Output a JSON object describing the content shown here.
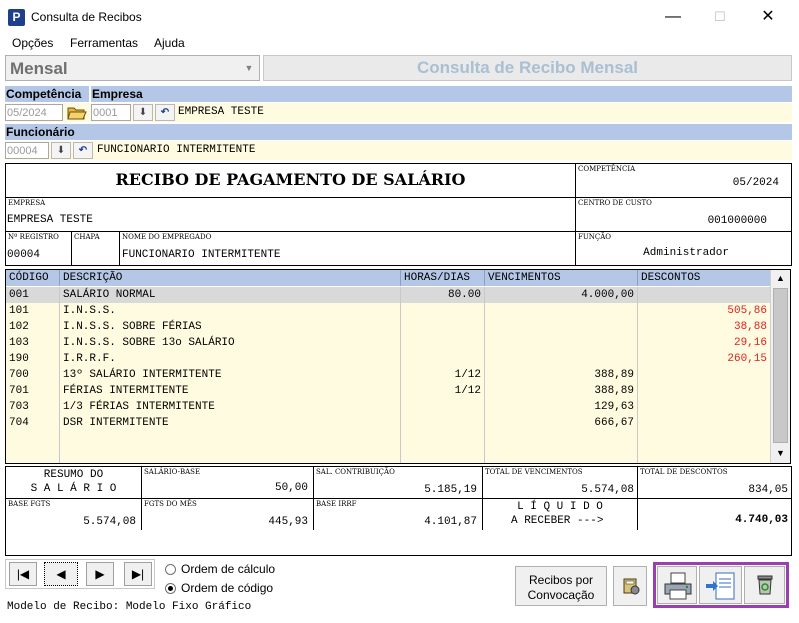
{
  "window": {
    "title": "Consulta de Recibos",
    "icon_letter": "P",
    "minimize": "—",
    "maximize": "☐",
    "close": "✕"
  },
  "menu": [
    "Opções",
    "Ferramentas",
    "Ajuda"
  ],
  "header": {
    "mode_selected": "Mensal",
    "screen_title": "Consulta de Recibo Mensal"
  },
  "filters": {
    "competencia_label": "Competência",
    "competencia_value": "05/2024",
    "empresa_label": "Empresa",
    "empresa_code": "0001",
    "empresa_name": "EMPRESA TESTE",
    "funcionario_label": "Funcionário",
    "funcionario_code": "00004",
    "funcionario_name": "FUNCIONARIO INTERMITENTE"
  },
  "receipt": {
    "title": "RECIBO DE PAGAMENTO DE SALÁRIO",
    "competencia_label": "COMPETÊNCIA",
    "competencia": "05/2024",
    "empresa_label": "EMPRESA",
    "empresa": "EMPRESA TESTE",
    "centro_custo_label": "CENTRO DE CUSTO",
    "centro_custo": "001000000",
    "registro_label": "Nº REGISTRO",
    "registro": "00004",
    "chapa_label": "CHAPA",
    "chapa": "",
    "nome_label": "NOME DO EMPREGADO",
    "nome": "FUNCIONARIO INTERMITENTE",
    "funcao_label": "FUNÇÃO",
    "funcao": "Administrador"
  },
  "grid": {
    "columns": [
      "CÓDIGO",
      "DESCRIÇÃO",
      "HORAS/DIAS",
      "VENCIMENTOS",
      "DESCONTOS"
    ],
    "rows": [
      {
        "code": "001",
        "desc": "SALÁRIO NORMAL",
        "hours": "80.00",
        "venc": "4.000,00",
        "desc_val": "",
        "highlight": true
      },
      {
        "code": "101",
        "desc": "I.N.S.S.",
        "hours": "",
        "venc": "",
        "desc_val": "505,86"
      },
      {
        "code": "102",
        "desc": "I.N.S.S. SOBRE FÉRIAS",
        "hours": "",
        "venc": "",
        "desc_val": "38,88"
      },
      {
        "code": "103",
        "desc": "I.N.S.S. SOBRE 13o SALÁRIO",
        "hours": "",
        "venc": "",
        "desc_val": "29,16"
      },
      {
        "code": "190",
        "desc": "I.R.R.F.",
        "hours": "",
        "venc": "",
        "desc_val": "260,15"
      },
      {
        "code": "700",
        "desc": "13º SALÁRIO INTERMITENTE",
        "hours": "1/12",
        "venc": "388,89",
        "desc_val": ""
      },
      {
        "code": "701",
        "desc": "FÉRIAS INTERMITENTE",
        "hours": "1/12",
        "venc": "388,89",
        "desc_val": ""
      },
      {
        "code": "703",
        "desc": "1/3 FÉRIAS INTERMITENTE",
        "hours": "",
        "venc": "129,63",
        "desc_val": ""
      },
      {
        "code": "704",
        "desc": "DSR INTERMITENTE",
        "hours": "",
        "venc": "666,67",
        "desc_val": ""
      }
    ]
  },
  "summary": {
    "resumo_line1": "RESUMO DO",
    "resumo_line2": "S A L Á R I O",
    "salario_base_label": "SALÁRIO-BASE",
    "salario_base": "50,00",
    "sal_contrib_label": "SAL. CONTRIBUIÇÃO",
    "sal_contrib": "5.185,19",
    "total_venc_label": "TOTAL DE VENCIMENTOS",
    "total_venc": "5.574,08",
    "total_desc_label": "TOTAL DE DESCONTOS",
    "total_desc": "834,05",
    "base_fgts_label": "BASE FGTS",
    "base_fgts": "5.574,08",
    "fgts_mes_label": "FGTS DO MÊS",
    "fgts_mes": "445,93",
    "base_irrf_label": "BASE IRRF",
    "base_irrf": "4.101,87",
    "liquido_line1": "L Í Q U I D O",
    "liquido_line2": "A RECEBER --->",
    "liquido": "4.740,03"
  },
  "footer": {
    "order_calc": "Ordem de cálculo",
    "order_code": "Ordem de código",
    "order_selected": "code",
    "recibos_btn_line1": "Recibos por",
    "recibos_btn_line2": "Convocação",
    "model_text": "Modelo de Recibo: Modelo Fixo Gráfico"
  },
  "colors": {
    "header_blue": "#b4c7e7",
    "row_yellow": "#fffbe0",
    "highlight_row": "#d9d9d9",
    "discount_red": "#e02020",
    "toolbar_border": "#9b3fb0"
  }
}
